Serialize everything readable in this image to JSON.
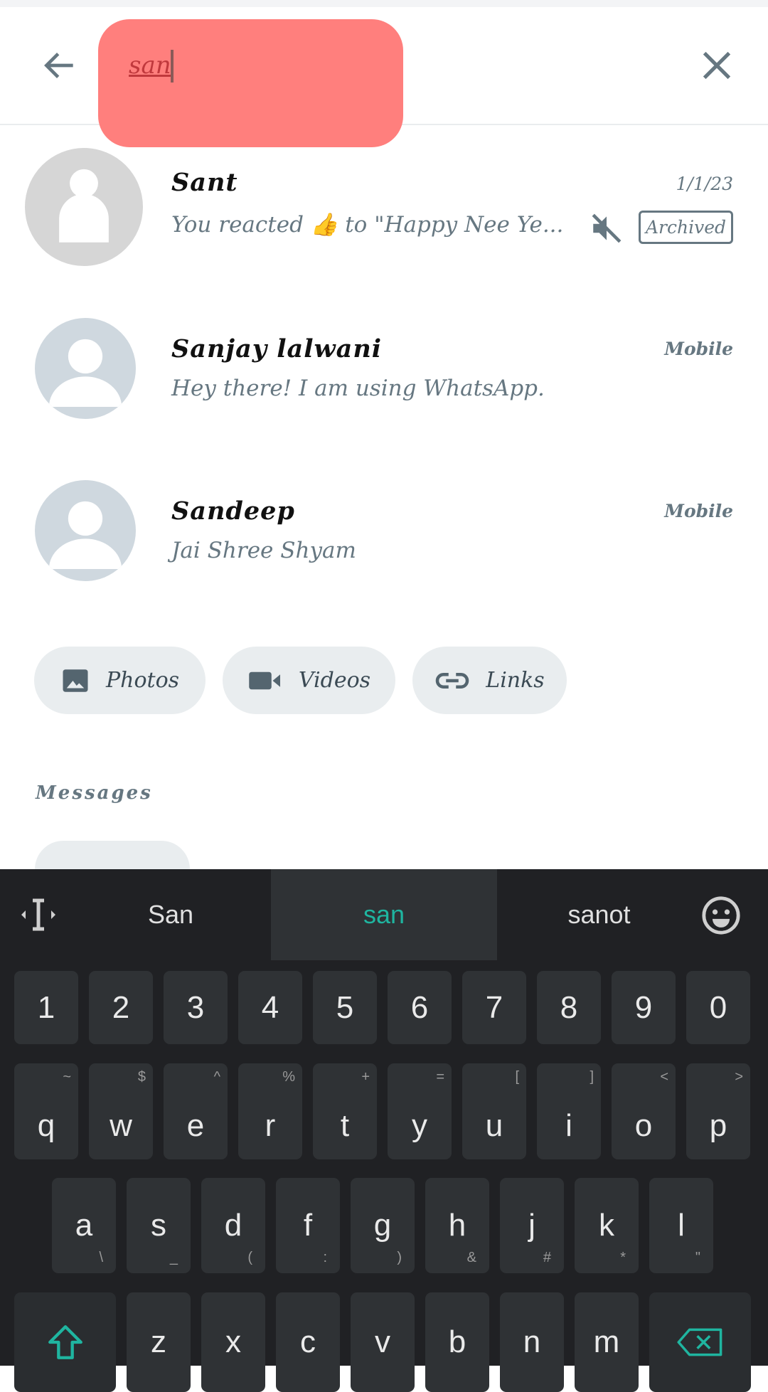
{
  "search": {
    "query": "san"
  },
  "results": [
    {
      "name": "Sant",
      "preview_before": "You reacted ",
      "emoji": "👍",
      "preview_after": " to \"Happy Nee Ye...",
      "date": "1/1/23",
      "muted": true,
      "badge": "Archived"
    },
    {
      "name": "Sanjay lalwani",
      "preview": "Hey there! I am using WhatsApp.",
      "label": "Mobile"
    },
    {
      "name": "Sandeep",
      "preview": "Jai Shree Shyam",
      "label": "Mobile"
    }
  ],
  "filters": [
    {
      "label": "Photos",
      "icon": "photo-icon"
    },
    {
      "label": "Videos",
      "icon": "video-icon"
    },
    {
      "label": "Links",
      "icon": "link-icon"
    }
  ],
  "section_title": "Messages",
  "keyboard": {
    "suggestions": [
      "San",
      "san",
      "sanot"
    ],
    "accent": "#1fb5a0",
    "rows": [
      [
        [
          "1"
        ],
        [
          "2"
        ],
        [
          "3"
        ],
        [
          "4"
        ],
        [
          "5"
        ],
        [
          "6"
        ],
        [
          "7"
        ],
        [
          "8"
        ],
        [
          "9"
        ],
        [
          "0"
        ]
      ],
      [
        [
          "q",
          "~"
        ],
        [
          "w",
          "$"
        ],
        [
          "e",
          "^"
        ],
        [
          "r",
          "%"
        ],
        [
          "t",
          "+"
        ],
        [
          "y",
          "="
        ],
        [
          "u",
          "["
        ],
        [
          "i",
          "]"
        ],
        [
          "o",
          "<"
        ],
        [
          "p",
          ">"
        ]
      ],
      [
        [
          "a",
          "\\"
        ],
        [
          "s",
          "_"
        ],
        [
          "d",
          "("
        ],
        [
          "f",
          ":"
        ],
        [
          "g",
          ")"
        ],
        [
          "h",
          "&"
        ],
        [
          "j",
          "#"
        ],
        [
          "k",
          "*"
        ],
        [
          "l",
          "\""
        ]
      ],
      [
        [
          "z"
        ],
        [
          "x"
        ],
        [
          "c"
        ],
        [
          "v"
        ],
        [
          "b"
        ],
        [
          "n"
        ],
        [
          "m"
        ]
      ]
    ]
  }
}
